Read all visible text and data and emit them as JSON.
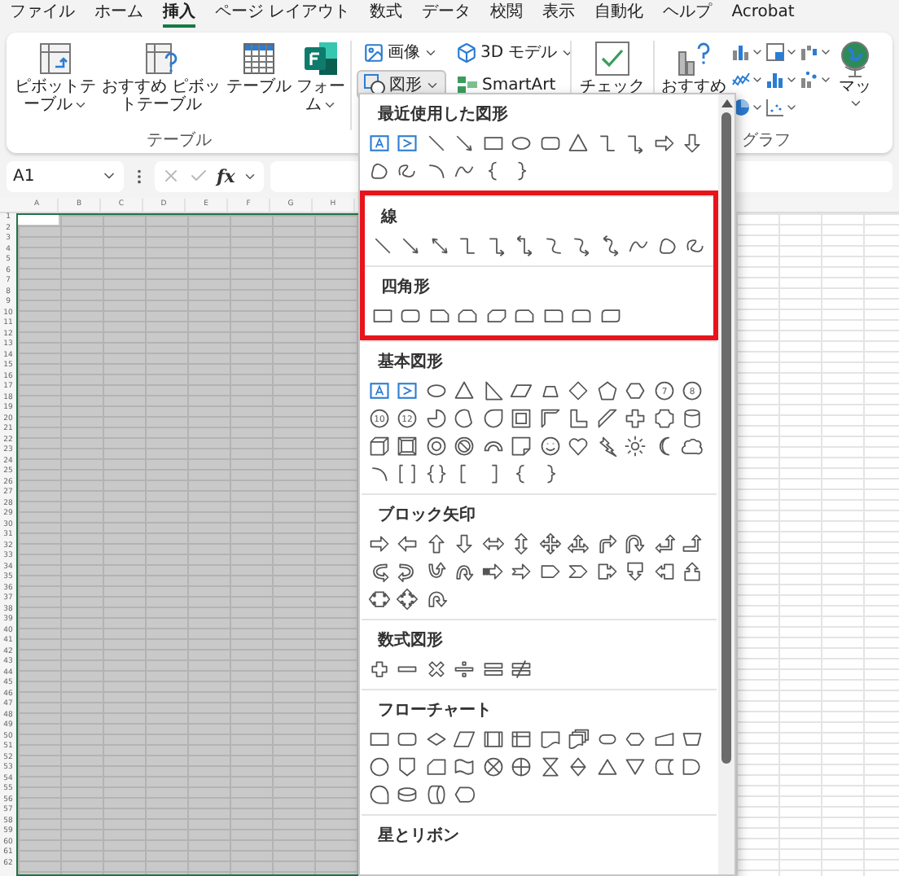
{
  "tabs": [
    {
      "label": "ファイル",
      "selected": false
    },
    {
      "label": "ホーム",
      "selected": false
    },
    {
      "label": "挿入",
      "selected": true
    },
    {
      "label": "ページ レイアウト",
      "selected": false
    },
    {
      "label": "数式",
      "selected": false
    },
    {
      "label": "データ",
      "selected": false
    },
    {
      "label": "校閲",
      "selected": false
    },
    {
      "label": "表示",
      "selected": false
    },
    {
      "label": "自動化",
      "selected": false
    },
    {
      "label": "ヘルプ",
      "selected": false
    },
    {
      "label": "Acrobat",
      "selected": false
    }
  ],
  "ribbon": {
    "table_group": {
      "label": "テーブル",
      "buttons": [
        {
          "kind": "pivot-table",
          "label": "ピボットテーブル",
          "dropdown": true
        },
        {
          "kind": "recommended-pivot",
          "label": "おすすめ ピボットテーブル",
          "dropdown": false
        },
        {
          "kind": "table",
          "label": "テーブル",
          "dropdown": false
        },
        {
          "kind": "forms",
          "label": "フォーム",
          "dropdown": true
        }
      ]
    },
    "illustrations": [
      {
        "kind": "image",
        "label": "画像",
        "dropdown": true,
        "pressed": false
      },
      {
        "kind": "model",
        "label": "3D モデル",
        "dropdown": true,
        "pressed": false
      },
      {
        "kind": "shapes",
        "label": "図形",
        "dropdown": true,
        "pressed": true
      },
      {
        "kind": "smartart",
        "label": "SmartArt",
        "dropdown": false,
        "pressed": false
      }
    ],
    "checkbox_button": {
      "label": "チェック"
    },
    "charts_group": {
      "label": "グラフ",
      "recommended": "おすすめ",
      "chart_buttons": [
        {
          "kind": "column"
        },
        {
          "kind": "hierarchy"
        },
        {
          "kind": "waterfall"
        },
        {
          "kind": "line"
        },
        {
          "kind": "statistic"
        },
        {
          "kind": "combo"
        },
        {
          "kind": "pie"
        },
        {
          "kind": "scatter"
        }
      ],
      "map": "マッ"
    }
  },
  "formula_bar": {
    "name_box": "A1",
    "function_button": "fx"
  },
  "sheet": {
    "columns": [
      "A",
      "B",
      "C",
      "D",
      "E",
      "F",
      "G",
      "H"
    ],
    "rows": [
      "1",
      "2",
      "3",
      "4",
      "5",
      "6",
      "7",
      "8",
      "9",
      "10",
      "11",
      "12",
      "13",
      "14",
      "15",
      "16",
      "17",
      "18",
      "19",
      "20",
      "21",
      "22",
      "23",
      "24",
      "25",
      "26",
      "27",
      "28",
      "29",
      "30",
      "31",
      "32",
      "33",
      "34",
      "35",
      "36",
      "37",
      "38",
      "39",
      "40",
      "41",
      "42",
      "43",
      "44",
      "45",
      "46",
      "47",
      "48",
      "49",
      "50",
      "51",
      "52",
      "53",
      "54",
      "55",
      "56",
      "57",
      "58",
      "59",
      "60",
      "61",
      "62"
    ]
  },
  "shape_menu": {
    "sections": [
      {
        "title": "最近使用した図形",
        "highlighted": false,
        "shapes": [
          {
            "kind": "textbox"
          },
          {
            "kind": "vertical-textbox"
          },
          {
            "kind": "line"
          },
          {
            "kind": "arrow"
          },
          {
            "kind": "rect"
          },
          {
            "kind": "ellipse"
          },
          {
            "kind": "round-rect"
          },
          {
            "kind": "triangle"
          },
          {
            "kind": "elbow"
          },
          {
            "kind": "elbow-arrow"
          },
          {
            "kind": "right-arrow"
          },
          {
            "kind": "down-arrow"
          },
          {
            "kind": "freeform"
          },
          {
            "kind": "scribble"
          },
          {
            "kind": "arc"
          },
          {
            "kind": "curve"
          },
          {
            "kind": "left-brace"
          },
          {
            "kind": "right-brace"
          }
        ]
      },
      {
        "title": "線",
        "highlighted": true,
        "shapes": [
          {
            "kind": "line"
          },
          {
            "kind": "arrow"
          },
          {
            "kind": "double-arrow"
          },
          {
            "kind": "elbow"
          },
          {
            "kind": "elbow-arrow"
          },
          {
            "kind": "elbow-double-arrow"
          },
          {
            "kind": "curved-connector"
          },
          {
            "kind": "curved-arrow"
          },
          {
            "kind": "curved-double-arrow"
          },
          {
            "kind": "curve"
          },
          {
            "kind": "freeform"
          },
          {
            "kind": "scribble"
          }
        ]
      },
      {
        "title": "四角形",
        "highlighted": true,
        "shapes": [
          {
            "kind": "rect"
          },
          {
            "kind": "round-rect"
          },
          {
            "kind": "snip-corner"
          },
          {
            "kind": "snip-top"
          },
          {
            "kind": "snip-diagonal"
          },
          {
            "kind": "snip-round"
          },
          {
            "kind": "round-corner"
          },
          {
            "kind": "round-top"
          },
          {
            "kind": "round-diagonal"
          }
        ]
      },
      {
        "title": "基本図形",
        "highlighted": false,
        "shapes": [
          {
            "kind": "textbox"
          },
          {
            "kind": "vertical-textbox"
          },
          {
            "kind": "ellipse"
          },
          {
            "kind": "triangle"
          },
          {
            "kind": "right-triangle"
          },
          {
            "kind": "parallelogram"
          },
          {
            "kind": "trapezoid"
          },
          {
            "kind": "diamond"
          },
          {
            "kind": "pentagon"
          },
          {
            "kind": "hexagon"
          },
          {
            "kind": "numbered-circle",
            "label": "7"
          },
          {
            "kind": "numbered-circle",
            "label": "8"
          },
          {
            "kind": "numbered-circle",
            "label": "10"
          },
          {
            "kind": "numbered-circle",
            "label": "12"
          },
          {
            "kind": "pie"
          },
          {
            "kind": "chord"
          },
          {
            "kind": "teardrop"
          },
          {
            "kind": "frame"
          },
          {
            "kind": "half-frame"
          },
          {
            "kind": "l-shape"
          },
          {
            "kind": "diagonal-stripe"
          },
          {
            "kind": "cross"
          },
          {
            "kind": "plaque"
          },
          {
            "kind": "can"
          },
          {
            "kind": "cube"
          },
          {
            "kind": "bevel"
          },
          {
            "kind": "donut"
          },
          {
            "kind": "no-symbol"
          },
          {
            "kind": "block-arc"
          },
          {
            "kind": "folded-corner"
          },
          {
            "kind": "smiley"
          },
          {
            "kind": "heart"
          },
          {
            "kind": "lightning"
          },
          {
            "kind": "sun"
          },
          {
            "kind": "moon"
          },
          {
            "kind": "cloud"
          },
          {
            "kind": "arc"
          },
          {
            "kind": "double-bracket"
          },
          {
            "kind": "double-brace"
          },
          {
            "kind": "left-bracket"
          },
          {
            "kind": "right-bracket"
          },
          {
            "kind": "left-brace"
          },
          {
            "kind": "right-brace"
          }
        ]
      },
      {
        "title": "ブロック矢印",
        "highlighted": false,
        "shapes": [
          {
            "kind": "right-arrow"
          },
          {
            "kind": "left-arrow"
          },
          {
            "kind": "up-arrow"
          },
          {
            "kind": "down-arrow"
          },
          {
            "kind": "left-right-arrow"
          },
          {
            "kind": "up-down-arrow"
          },
          {
            "kind": "quad-arrow"
          },
          {
            "kind": "left-right-up-arrow"
          },
          {
            "kind": "bent-arrow"
          },
          {
            "kind": "u-turn-arrow"
          },
          {
            "kind": "left-up-arrow"
          },
          {
            "kind": "bent-up-arrow"
          },
          {
            "kind": "curved-right-arrow"
          },
          {
            "kind": "curved-left-arrow"
          },
          {
            "kind": "curved-up-arrow"
          },
          {
            "kind": "curved-down-arrow"
          },
          {
            "kind": "striped-right-arrow"
          },
          {
            "kind": "notched-right-arrow"
          },
          {
            "kind": "pentagon-arrow"
          },
          {
            "kind": "chevron"
          },
          {
            "kind": "right-callout"
          },
          {
            "kind": "down-callout"
          },
          {
            "kind": "left-callout"
          },
          {
            "kind": "up-callout"
          },
          {
            "kind": "left-right-callout"
          },
          {
            "kind": "quad-callout"
          },
          {
            "kind": "circular-arrow"
          }
        ]
      },
      {
        "title": "数式図形",
        "highlighted": false,
        "shapes": [
          {
            "kind": "plus"
          },
          {
            "kind": "minus"
          },
          {
            "kind": "multiply"
          },
          {
            "kind": "divide"
          },
          {
            "kind": "equal"
          },
          {
            "kind": "not-equal"
          }
        ]
      },
      {
        "title": "フローチャート",
        "highlighted": false,
        "shapes": [
          {
            "kind": "process"
          },
          {
            "kind": "alternate-process"
          },
          {
            "kind": "decision"
          },
          {
            "kind": "data"
          },
          {
            "kind": "predefined-process"
          },
          {
            "kind": "internal-storage"
          },
          {
            "kind": "document"
          },
          {
            "kind": "multidocument"
          },
          {
            "kind": "terminator"
          },
          {
            "kind": "preparation"
          },
          {
            "kind": "manual-input"
          },
          {
            "kind": "manual-operation"
          },
          {
            "kind": "connector"
          },
          {
            "kind": "off-page-connector"
          },
          {
            "kind": "card"
          },
          {
            "kind": "punched-tape"
          },
          {
            "kind": "summing-junction"
          },
          {
            "kind": "or"
          },
          {
            "kind": "collate"
          },
          {
            "kind": "sort"
          },
          {
            "kind": "extract"
          },
          {
            "kind": "merge"
          },
          {
            "kind": "stored-data"
          },
          {
            "kind": "delay"
          },
          {
            "kind": "sequential-access"
          },
          {
            "kind": "magnetic-disk"
          },
          {
            "kind": "direct-access"
          },
          {
            "kind": "display"
          }
        ]
      },
      {
        "title": "星とリボン",
        "highlighted": false
      }
    ]
  }
}
